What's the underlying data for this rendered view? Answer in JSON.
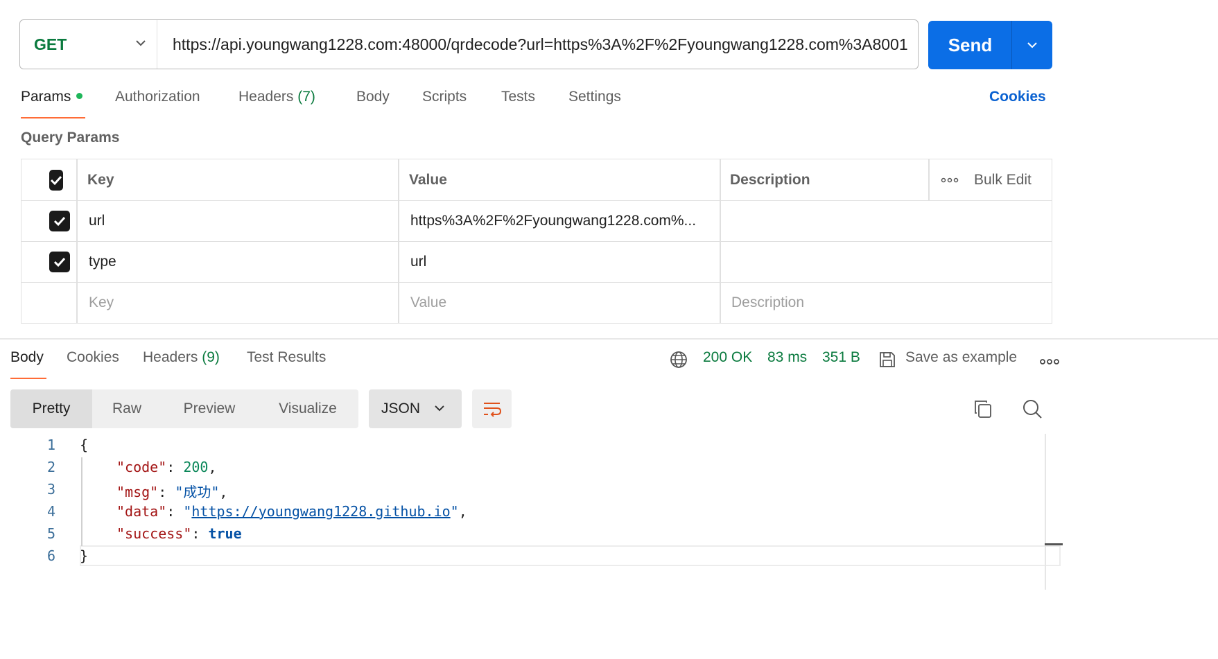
{
  "request": {
    "method": "GET",
    "url": "https://api.youngwang1228.com:48000/qrdecode?url=https%3A%2F%2Fyoungwang1228.com%3A8001",
    "send_label": "Send"
  },
  "request_tabs": {
    "params": "Params",
    "authorization": "Authorization",
    "headers": "Headers",
    "headers_count": "(7)",
    "body": "Body",
    "scripts": "Scripts",
    "tests": "Tests",
    "settings": "Settings",
    "cookies": "Cookies"
  },
  "query_params": {
    "title": "Query Params",
    "columns": {
      "key": "Key",
      "value": "Value",
      "description": "Description",
      "bulk_edit": "Bulk Edit"
    },
    "rows": [
      {
        "key": "url",
        "value": "https%3A%2F%2Fyoungwang1228.com%...",
        "enabled": true
      },
      {
        "key": "type",
        "value": "url",
        "enabled": true
      }
    ],
    "placeholders": {
      "key": "Key",
      "value": "Value",
      "description": "Description"
    }
  },
  "response_tabs": {
    "body": "Body",
    "cookies": "Cookies",
    "headers": "Headers",
    "headers_count": "(9)",
    "test_results": "Test Results"
  },
  "response_status": {
    "status": "200 OK",
    "time": "83 ms",
    "size": "351 B",
    "save_example": "Save as example"
  },
  "view_modes": {
    "pretty": "Pretty",
    "raw": "Raw",
    "preview": "Preview",
    "visualize": "Visualize",
    "format": "JSON"
  },
  "code": {
    "line_numbers": [
      "1",
      "2",
      "3",
      "4",
      "5",
      "6"
    ],
    "open_brace": "{",
    "close_brace": "}",
    "k_code": "\"code\"",
    "v_code": "200",
    "k_msg": "\"msg\"",
    "v_msg": "\"成功\"",
    "k_data": "\"data\"",
    "v_data_url": "https://youngwang1228.github.io",
    "k_success": "\"success\"",
    "v_success": "true"
  },
  "colors": {
    "accent": "#ff6c37",
    "send_button": "#0b6ee6",
    "status_green": "#0a7a3e",
    "link_blue": "#0b62d1"
  }
}
